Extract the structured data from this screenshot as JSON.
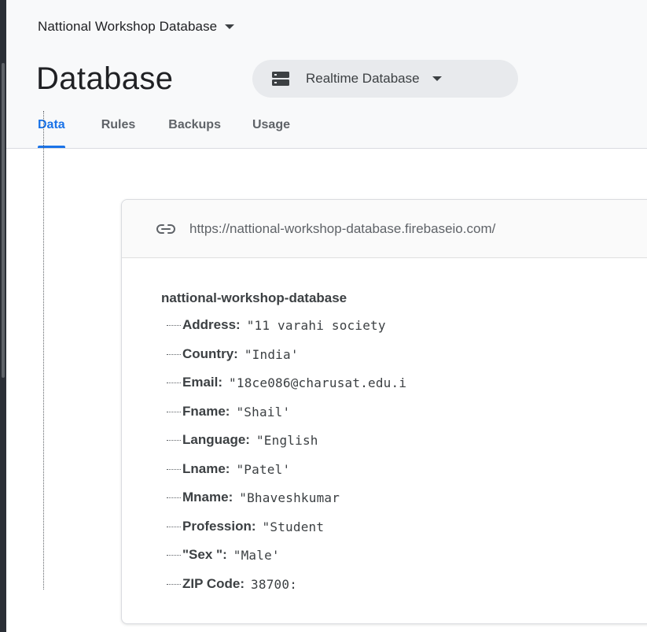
{
  "project": {
    "name": "Nattional Workshop Database"
  },
  "page": {
    "title": "Database"
  },
  "db_selector": {
    "label": "Realtime Database"
  },
  "tabs": [
    {
      "label": "Data",
      "active": true
    },
    {
      "label": "Rules",
      "active": false
    },
    {
      "label": "Backups",
      "active": false
    },
    {
      "label": "Usage",
      "active": false
    }
  ],
  "data_viewer": {
    "url": "https://nattional-workshop-database.firebaseio.com/",
    "root_key": "nattional-workshop-database",
    "entries": [
      {
        "key": "Address",
        "value": "\"11 varahi society"
      },
      {
        "key": "Country",
        "value": "\"India'"
      },
      {
        "key": "Email",
        "value": "\"18ce086@charusat.edu.i"
      },
      {
        "key": "Fname",
        "value": "\"Shail'"
      },
      {
        "key": "Language",
        "value": "\"English"
      },
      {
        "key": "Lname",
        "value": "\"Patel'"
      },
      {
        "key": "Mname",
        "value": "\"Bhaveshkumar"
      },
      {
        "key": "Profession",
        "value": "\"Student"
      },
      {
        "key": "\"Sex \"",
        "value": "\"Male'"
      },
      {
        "key": "ZIP Code",
        "value": "38700:"
      }
    ]
  },
  "colors": {
    "accent": "#1a73e8",
    "header_bg": "#f8f9fa",
    "selector_bg": "#e8eaed",
    "text": "#202124",
    "muted": "#5f6368"
  },
  "icons": {
    "project_caret": "chevron-down-icon",
    "db_icon": "database-icon",
    "url_icon": "link-icon"
  }
}
